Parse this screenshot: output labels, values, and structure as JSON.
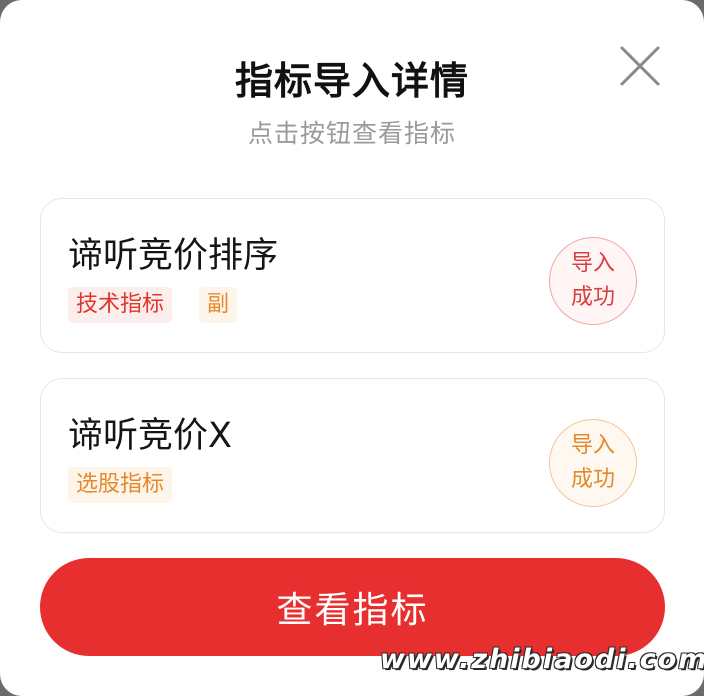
{
  "dialog": {
    "title": "指标导入详情",
    "subtitle": "点击按钮查看指标",
    "close_icon": "close-icon"
  },
  "indicators": [
    {
      "name": "谛听竞价排序",
      "tags": [
        "技术指标",
        "副"
      ],
      "status_line1": "导入",
      "status_line2": "成功",
      "status_color": "#d94040"
    },
    {
      "name": "谛听竞价X",
      "tags": [
        "选股指标"
      ],
      "status_line1": "导入",
      "status_line2": "成功",
      "status_color": "#e08a2e"
    }
  ],
  "primary_button": {
    "label": "查看指标",
    "color": "#e82f2f"
  },
  "watermark": "www.zhibiaodi.com"
}
